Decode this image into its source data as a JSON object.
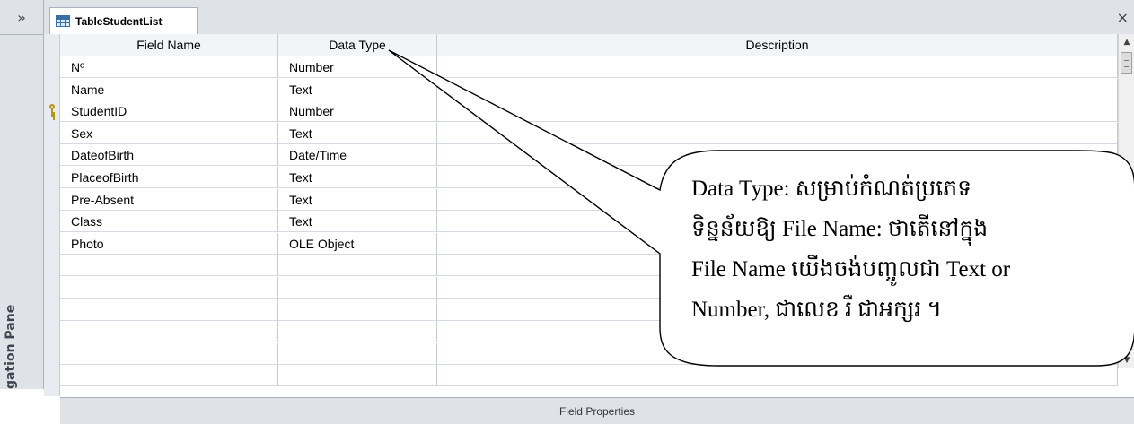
{
  "nav_pane": {
    "toggle": "»",
    "label": "gation Pane"
  },
  "tab": {
    "title": "TableStudentList",
    "close": "×"
  },
  "columns": {
    "field_name": "Field Name",
    "data_type": "Data Type",
    "description": "Description"
  },
  "rows": [
    {
      "field": "Nº",
      "type": "Number",
      "key": false
    },
    {
      "field": "Name",
      "type": "Text",
      "key": false
    },
    {
      "field": "StudentID",
      "type": "Number",
      "key": true
    },
    {
      "field": "Sex",
      "type": "Text",
      "key": false
    },
    {
      "field": "DateofBirth",
      "type": "Date/Time",
      "key": false
    },
    {
      "field": "PlaceofBirth",
      "type": "Text",
      "key": false
    },
    {
      "field": "Pre-Absent",
      "type": "Text",
      "key": false
    },
    {
      "field": "Class",
      "type": "Text",
      "key": false
    },
    {
      "field": "Photo",
      "type": "OLE Object",
      "key": false
    },
    {
      "field": "",
      "type": "",
      "key": false
    },
    {
      "field": "",
      "type": "",
      "key": false
    },
    {
      "field": "",
      "type": "",
      "key": false
    },
    {
      "field": "",
      "type": "",
      "key": false
    },
    {
      "field": "",
      "type": "",
      "key": false
    },
    {
      "field": "",
      "type": "",
      "key": false
    }
  ],
  "field_properties_label": "Field Properties",
  "callout": {
    "lines": [
      "Data Type: សម្រាប់កំណត់ប្រភេទ",
      "ទិន្នន័យឱ្យ File Name: ថាតើនៅក្នុង",
      "File Name យើងចង់បញ្ចូលជា Text or",
      "Number, ជាលេខ រឺ ជាអក្សរ ។"
    ]
  },
  "icons": {
    "nav_toggle": "double-chevron-icon",
    "table": "table-icon",
    "close": "close-icon",
    "primary_key": "key-icon",
    "scroll_up": "arrow-up-icon",
    "scroll_down": "arrow-down-icon"
  },
  "colors": {
    "chrome": "#dfe3e8",
    "key": "#b8960e",
    "table_icon": "#3a6fa8"
  }
}
